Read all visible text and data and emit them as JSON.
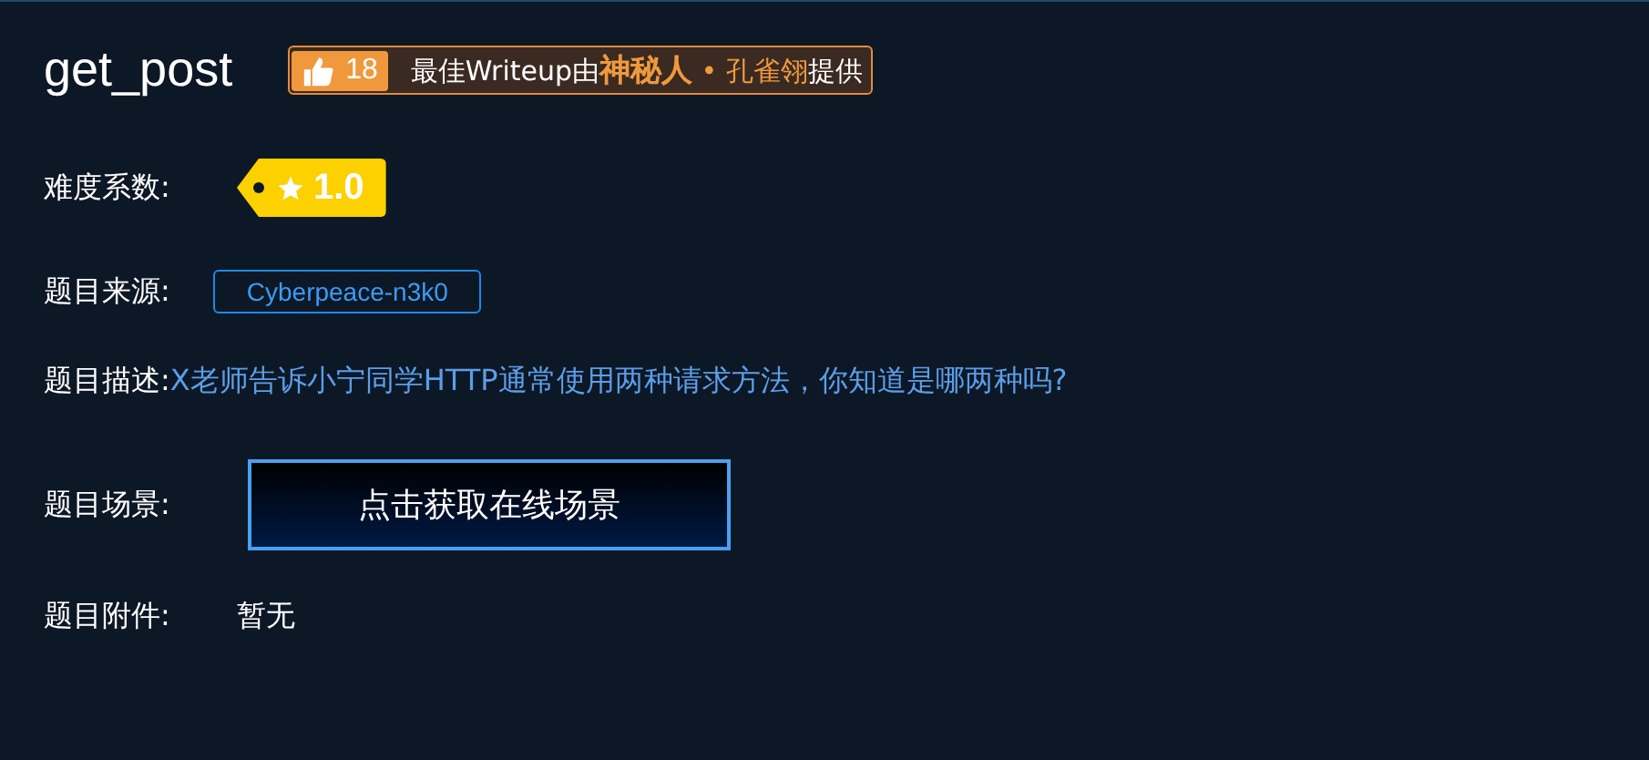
{
  "title": "get_post",
  "writeup_badge": {
    "likes": "18",
    "parts": [
      {
        "kind": "plain",
        "text": "最佳Writeup由"
      },
      {
        "kind": "strong",
        "text": "神秘人"
      },
      {
        "kind": "accent",
        "text": " • 孔雀翎"
      },
      {
        "kind": "plain",
        "text": "提供"
      }
    ]
  },
  "fields": [
    {
      "kind": "difficulty",
      "label": "难度系数:",
      "value": "1.0"
    },
    {
      "kind": "tag",
      "label": "题目来源:",
      "value": "Cyberpeace-n3k0"
    },
    {
      "kind": "text",
      "label": "题目描述:",
      "value": "X老师告诉小宁同学HTTP通常使用两种请求方法，你知道是哪两种吗?"
    },
    {
      "kind": "button",
      "label": "题目场景:",
      "value": "点击获取在线场景"
    },
    {
      "kind": "plain",
      "label": "题目附件:",
      "value": "暂无"
    }
  ]
}
